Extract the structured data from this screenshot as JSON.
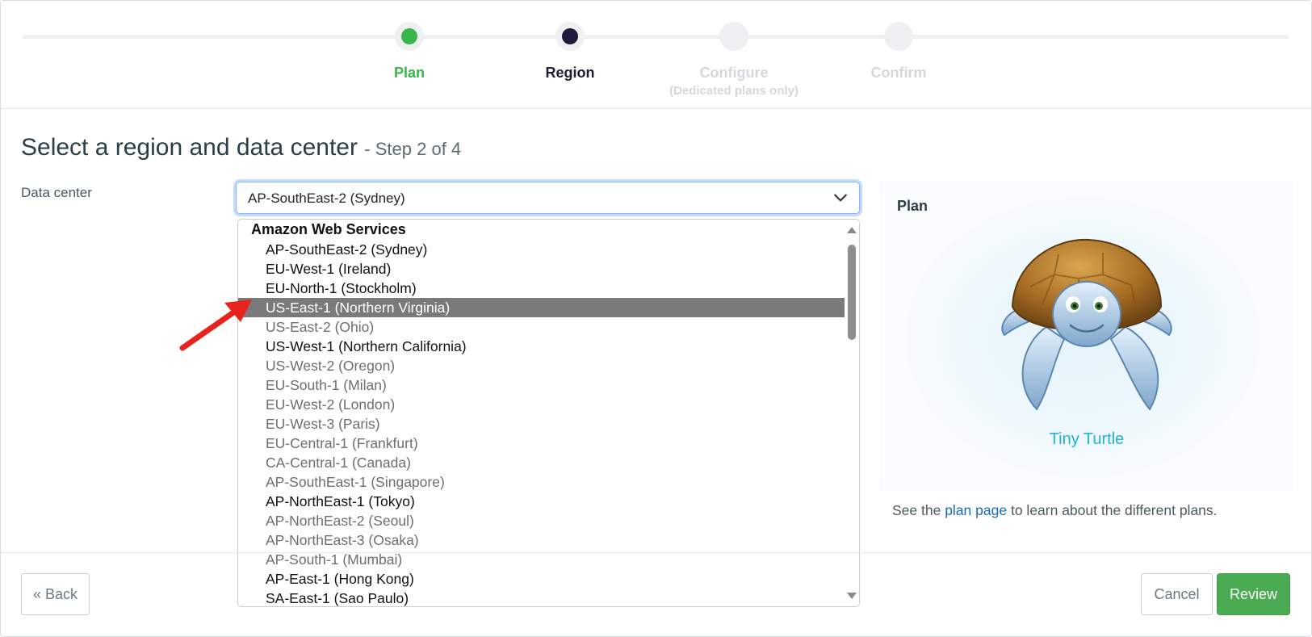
{
  "stepper": {
    "steps": [
      {
        "label": "Plan",
        "color": "#3ab54a"
      },
      {
        "label": "Region",
        "color": "#1e1b3a"
      },
      {
        "label": "Configure",
        "sub": "(Dedicated plans only)",
        "color": "#d4d8db"
      },
      {
        "label": "Confirm",
        "color": "#d4d8db"
      }
    ]
  },
  "heading": {
    "title": "Select a region and data center",
    "step_text": "- Step 2 of 4"
  },
  "form": {
    "data_center_label": "Data center",
    "selected_value": "AP-SouthEast-2 (Sydney)"
  },
  "dropdown": {
    "group_label": "Amazon Web Services",
    "options": [
      {
        "label": "AP-SouthEast-2 (Sydney)",
        "enabled": true
      },
      {
        "label": "EU-West-1 (Ireland)",
        "enabled": true
      },
      {
        "label": "EU-North-1 (Stockholm)",
        "enabled": true
      },
      {
        "label": "US-East-1 (Northern Virginia)",
        "enabled": false,
        "highlighted": true
      },
      {
        "label": "US-East-2 (Ohio)",
        "enabled": false
      },
      {
        "label": "US-West-1 (Northern California)",
        "enabled": true
      },
      {
        "label": "US-West-2 (Oregon)",
        "enabled": false
      },
      {
        "label": "EU-South-1 (Milan)",
        "enabled": false
      },
      {
        "label": "EU-West-2 (London)",
        "enabled": false
      },
      {
        "label": "EU-West-3 (Paris)",
        "enabled": false
      },
      {
        "label": "EU-Central-1 (Frankfurt)",
        "enabled": false
      },
      {
        "label": "CA-Central-1 (Canada)",
        "enabled": false
      },
      {
        "label": "AP-SouthEast-1 (Singapore)",
        "enabled": false
      },
      {
        "label": "AP-NorthEast-1 (Tokyo)",
        "enabled": true
      },
      {
        "label": "AP-NorthEast-2 (Seoul)",
        "enabled": false
      },
      {
        "label": "AP-NorthEast-3 (Osaka)",
        "enabled": false
      },
      {
        "label": "AP-South-1 (Mumbai)",
        "enabled": false
      },
      {
        "label": "AP-East-1 (Hong Kong)",
        "enabled": true
      },
      {
        "label": "SA-East-1 (Sao Paulo)",
        "enabled": true
      }
    ]
  },
  "plan_panel": {
    "title": "Plan",
    "plan_name": "Tiny Turtle",
    "note_prefix": "See the",
    "note_link": "plan page",
    "note_suffix": "to learn about the different plans."
  },
  "footer": {
    "back_label": "« Back",
    "cancel_label": "Cancel",
    "review_label": "Review"
  },
  "icons": {
    "select_chevron": "chevron-down-icon",
    "annotation": "red-arrow-icon"
  }
}
